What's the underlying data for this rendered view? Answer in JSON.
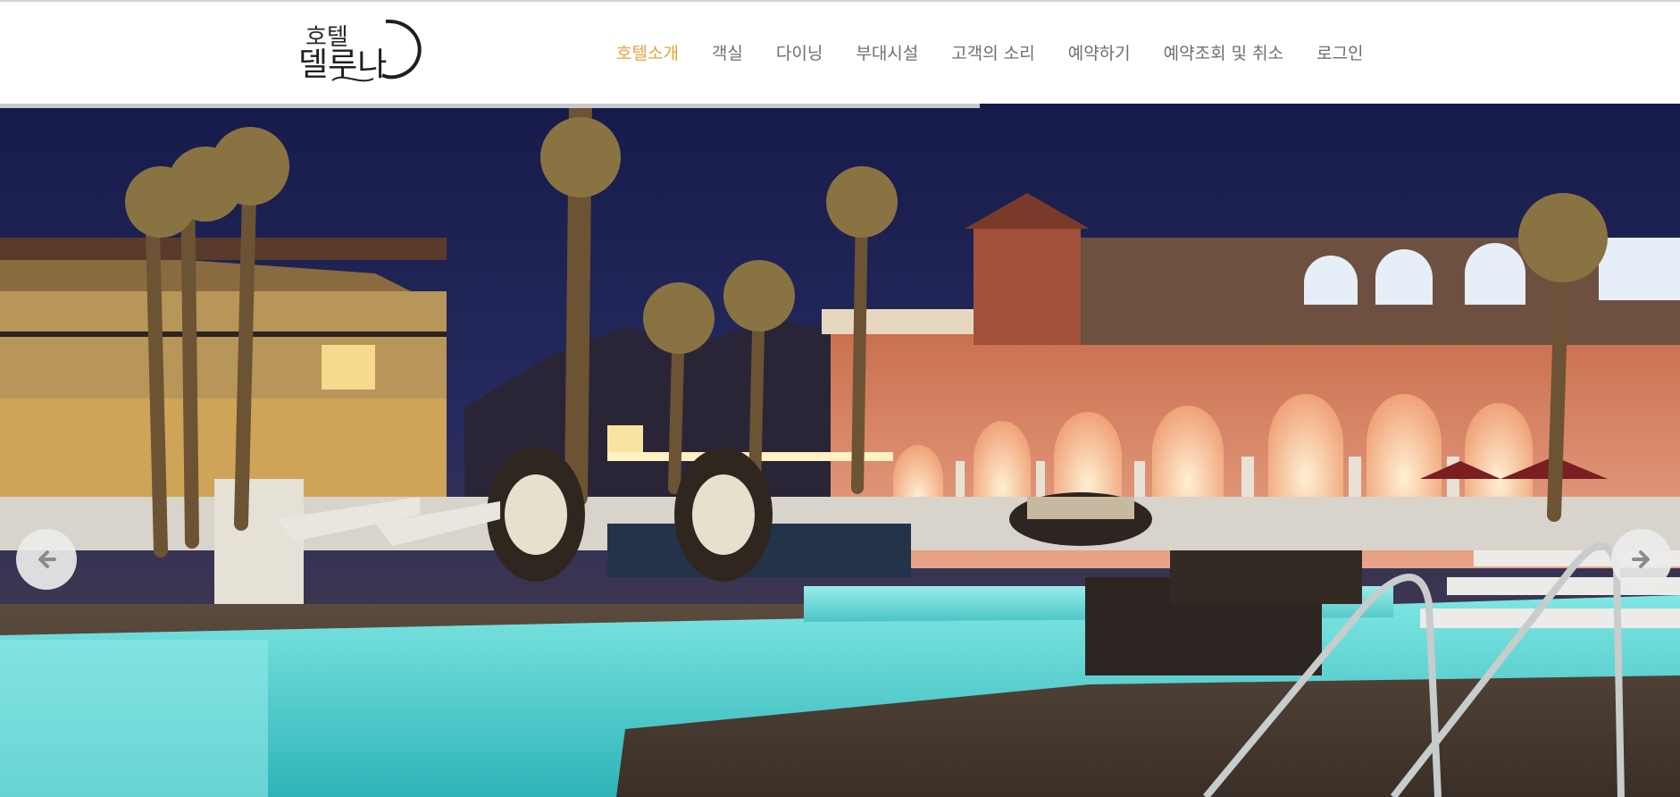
{
  "header": {
    "logo": {
      "line1": "호텔",
      "line2": "델루나"
    },
    "nav": [
      {
        "label": "호텔소개",
        "active": true
      },
      {
        "label": "객실",
        "active": false
      },
      {
        "label": "다이닝",
        "active": false
      },
      {
        "label": "부대시설",
        "active": false
      },
      {
        "label": "고객의 소리",
        "active": false
      },
      {
        "label": "예약하기",
        "active": false
      },
      {
        "label": "예약조회 및 취소",
        "active": false
      },
      {
        "label": "로그인",
        "active": false
      }
    ],
    "active_color": "#e8a23a",
    "link_color": "#6f6f6f"
  },
  "slider": {
    "image": "hotel-pool-night-photo",
    "progress": 0.583,
    "prev_icon": "arrow-left-icon",
    "next_icon": "arrow-right-icon"
  }
}
